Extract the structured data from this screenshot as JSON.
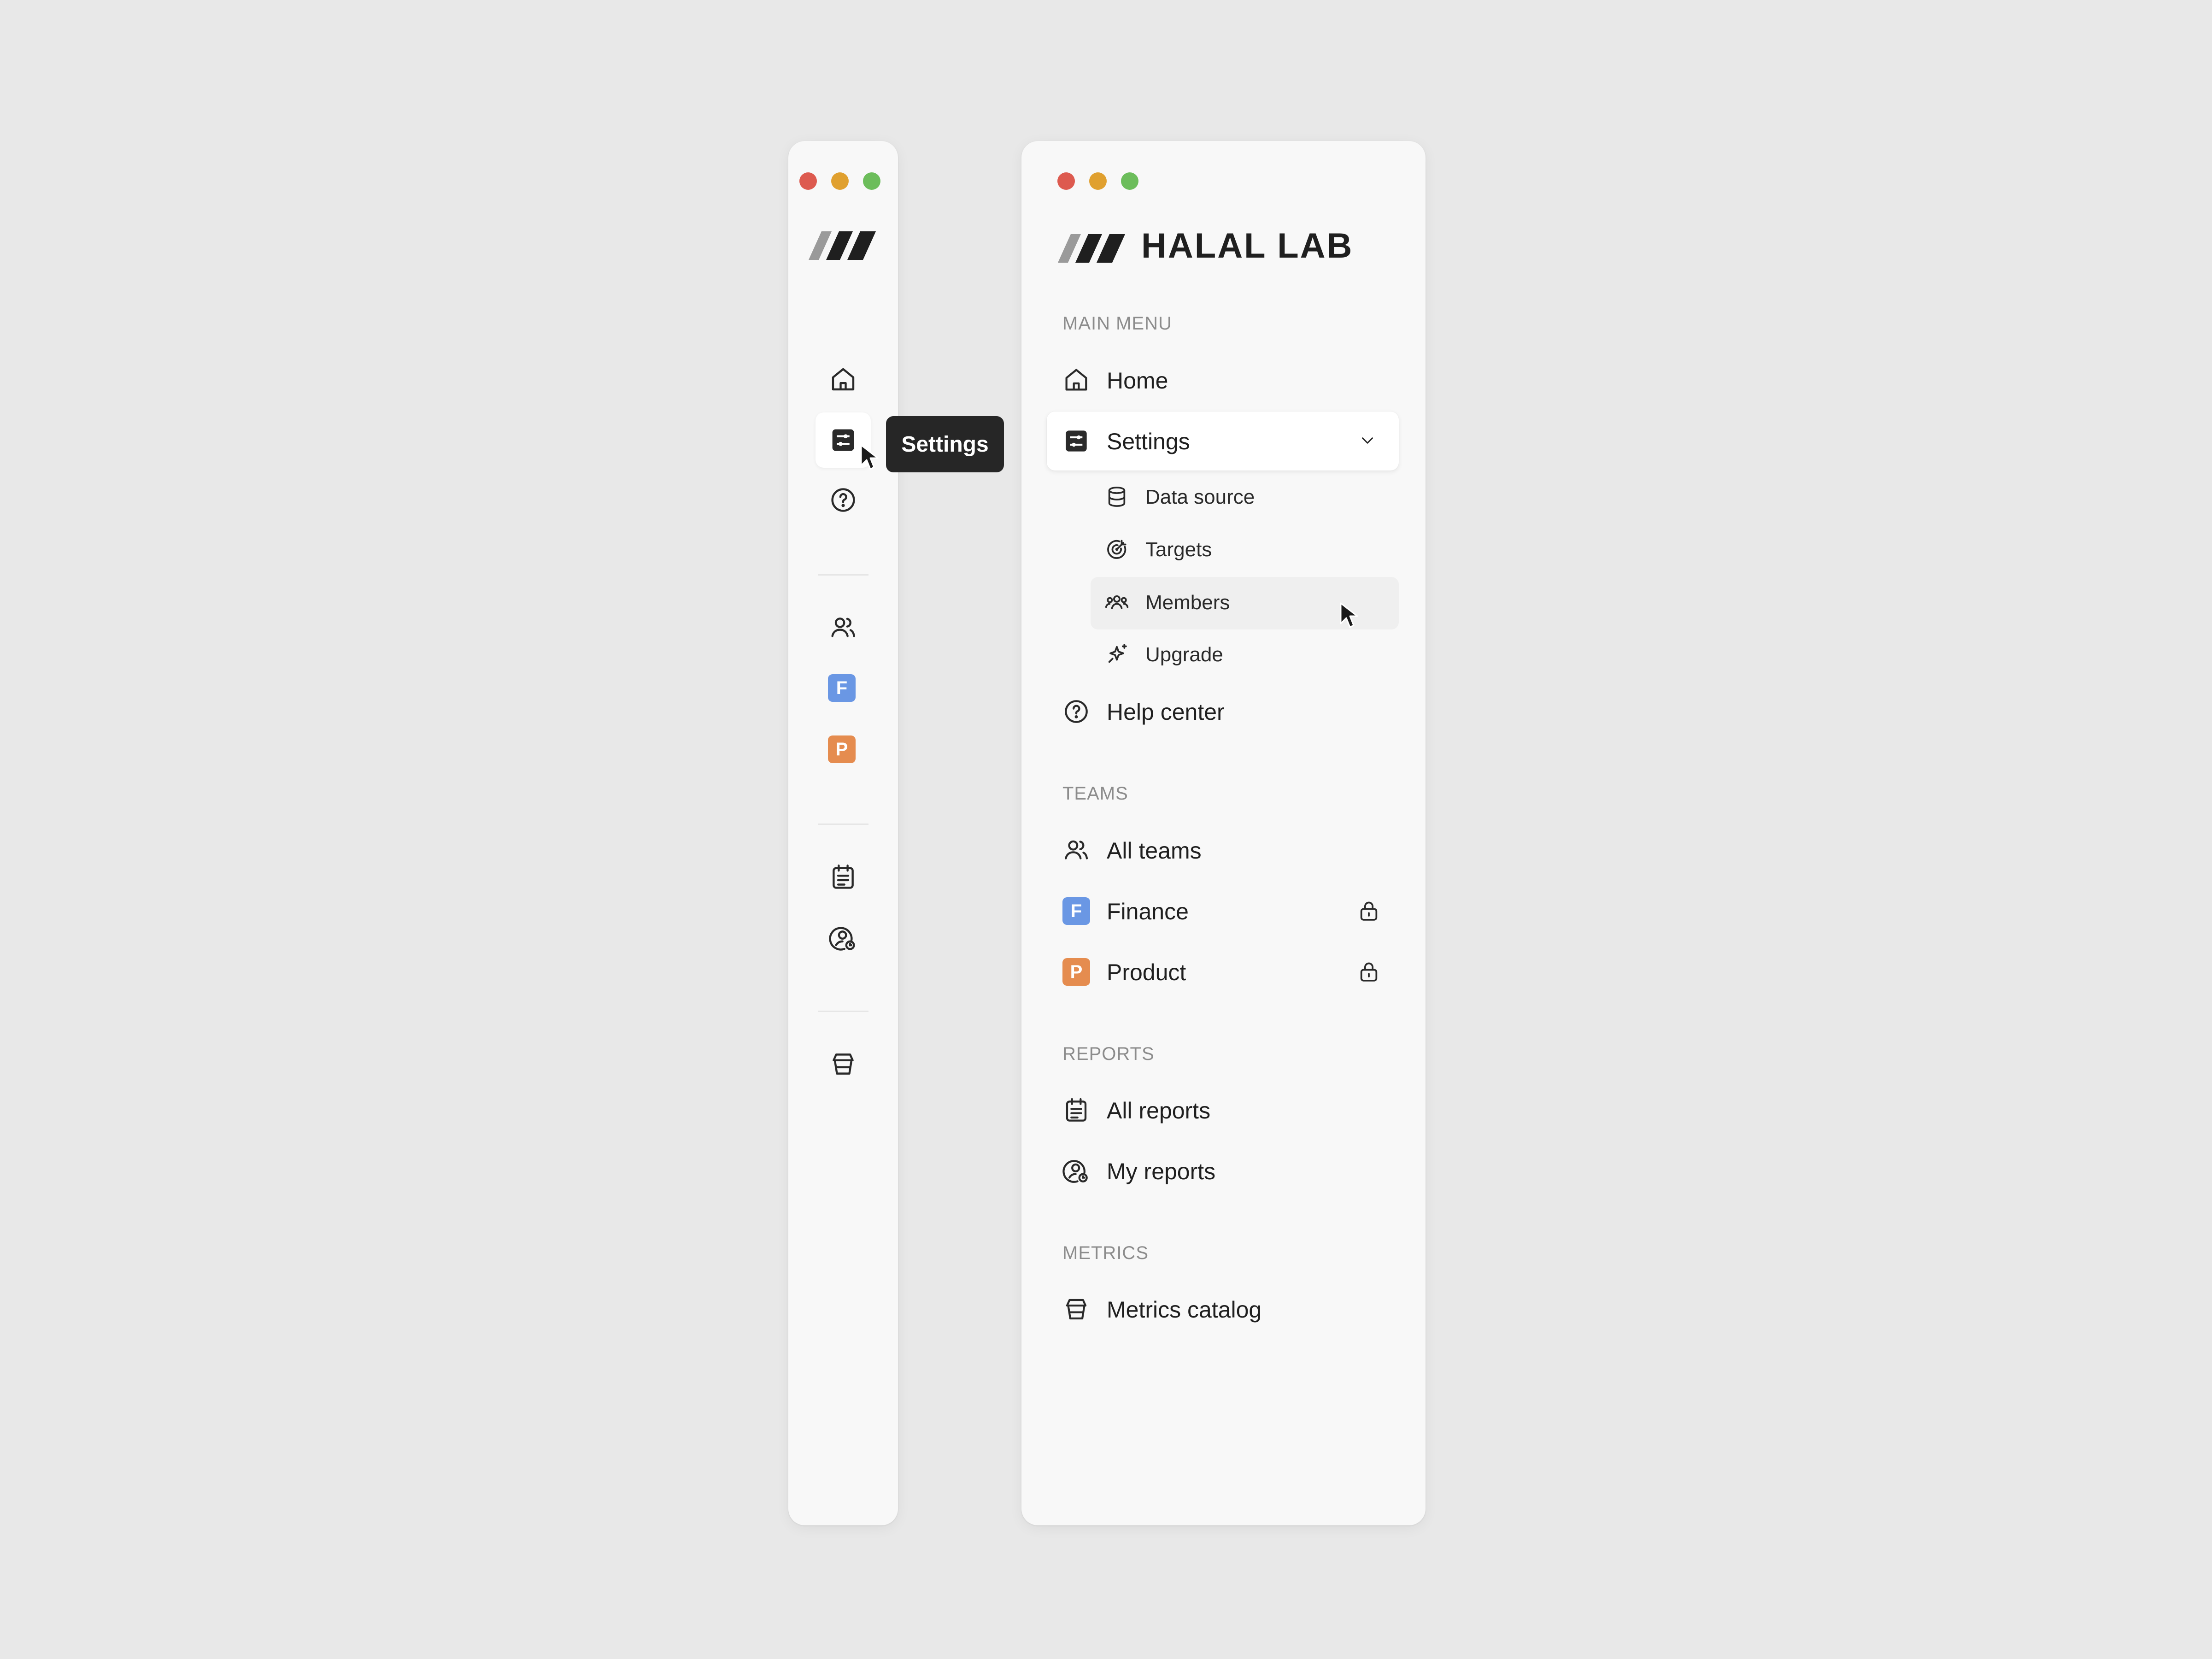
{
  "tooltip": {
    "text": "Settings"
  },
  "brand": {
    "name": "HALAL LAB"
  },
  "colors": {
    "traffic_red": "#dd5a4f",
    "traffic_yellow": "#e0a02f",
    "traffic_green": "#6cbd5b",
    "finance_badge": "#6a97e4",
    "product_badge": "#e58c4f",
    "tooltip_bg": "#262626"
  },
  "sections": {
    "main_menu": "MAIN MENU",
    "teams": "TEAMS",
    "reports": "REPORTS",
    "metrics": "METRICS"
  },
  "nav": {
    "home": {
      "label": "Home",
      "icon": "home-icon"
    },
    "settings": {
      "label": "Settings",
      "icon": "settings-sliders-icon",
      "expanded": true
    },
    "settings_sub": [
      {
        "label": "Data source",
        "icon": "database-icon"
      },
      {
        "label": "Targets",
        "icon": "target-icon"
      },
      {
        "label": "Members",
        "icon": "members-icon"
      },
      {
        "label": "Upgrade",
        "icon": "sparkle-icon"
      }
    ],
    "help": {
      "label": "Help center",
      "icon": "help-icon"
    },
    "all_teams": {
      "label": "All teams",
      "icon": "users-icon"
    },
    "finance": {
      "label": "Finance",
      "badge": "F",
      "locked": true
    },
    "product": {
      "label": "Product",
      "badge": "P",
      "locked": true
    },
    "all_reports": {
      "label": "All reports",
      "icon": "calendar-report-icon"
    },
    "my_reports": {
      "label": "My reports",
      "icon": "user-report-icon"
    },
    "metrics_catalog": {
      "label": "Metrics catalog",
      "icon": "metrics-bucket-icon"
    }
  }
}
